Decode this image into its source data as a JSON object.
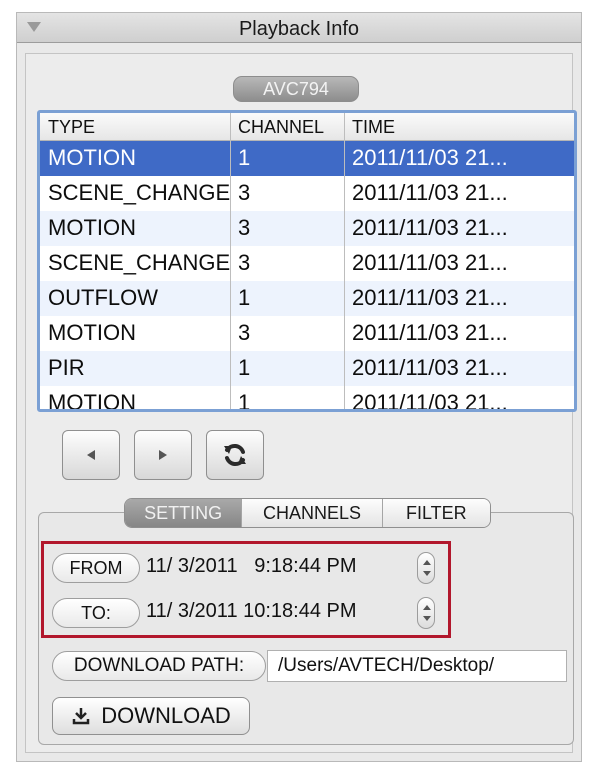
{
  "panel": {
    "title": "Playback Info",
    "device": "AVC794"
  },
  "table": {
    "columns": [
      "TYPE",
      "CHANNEL",
      "TIME"
    ],
    "rows": [
      {
        "type": "MOTION",
        "channel": "1",
        "time": "2011/11/03 21..."
      },
      {
        "type": "SCENE_CHANGE",
        "channel": "3",
        "time": "2011/11/03 21..."
      },
      {
        "type": "MOTION",
        "channel": "3",
        "time": "2011/11/03 21..."
      },
      {
        "type": "SCENE_CHANGE",
        "channel": "3",
        "time": "2011/11/03 21..."
      },
      {
        "type": "OUTFLOW",
        "channel": "1",
        "time": "2011/11/03 21..."
      },
      {
        "type": "MOTION",
        "channel": "3",
        "time": "2011/11/03 21..."
      },
      {
        "type": "PIR",
        "channel": "1",
        "time": "2011/11/03 21..."
      },
      {
        "type": "MOTION",
        "channel": "1",
        "time": "2011/11/03 21..."
      }
    ],
    "selected_index": 0
  },
  "nav": {
    "prev_icon": "left-arrow-icon",
    "next_icon": "right-arrow-icon",
    "refresh_icon": "refresh-icon"
  },
  "tabs": [
    {
      "label": "SETTING",
      "active": true
    },
    {
      "label": "CHANNELS",
      "active": false
    },
    {
      "label": "FILTER",
      "active": false
    }
  ],
  "range": {
    "from_label": "FROM",
    "from_value": "11/ 3/2011   9:18:44 PM",
    "to_label": "TO:",
    "to_value": "11/ 3/2011 10:18:44 PM"
  },
  "download": {
    "path_label": "DOWNLOAD PATH:",
    "path_value": "/Users/AVTECH/Desktop/",
    "button_label": "DOWNLOAD",
    "button_icon": "download-icon"
  },
  "colors": {
    "selection": "#3f6ac6",
    "alt_row": "#edf3fd",
    "highlight_box": "#b2172c"
  }
}
